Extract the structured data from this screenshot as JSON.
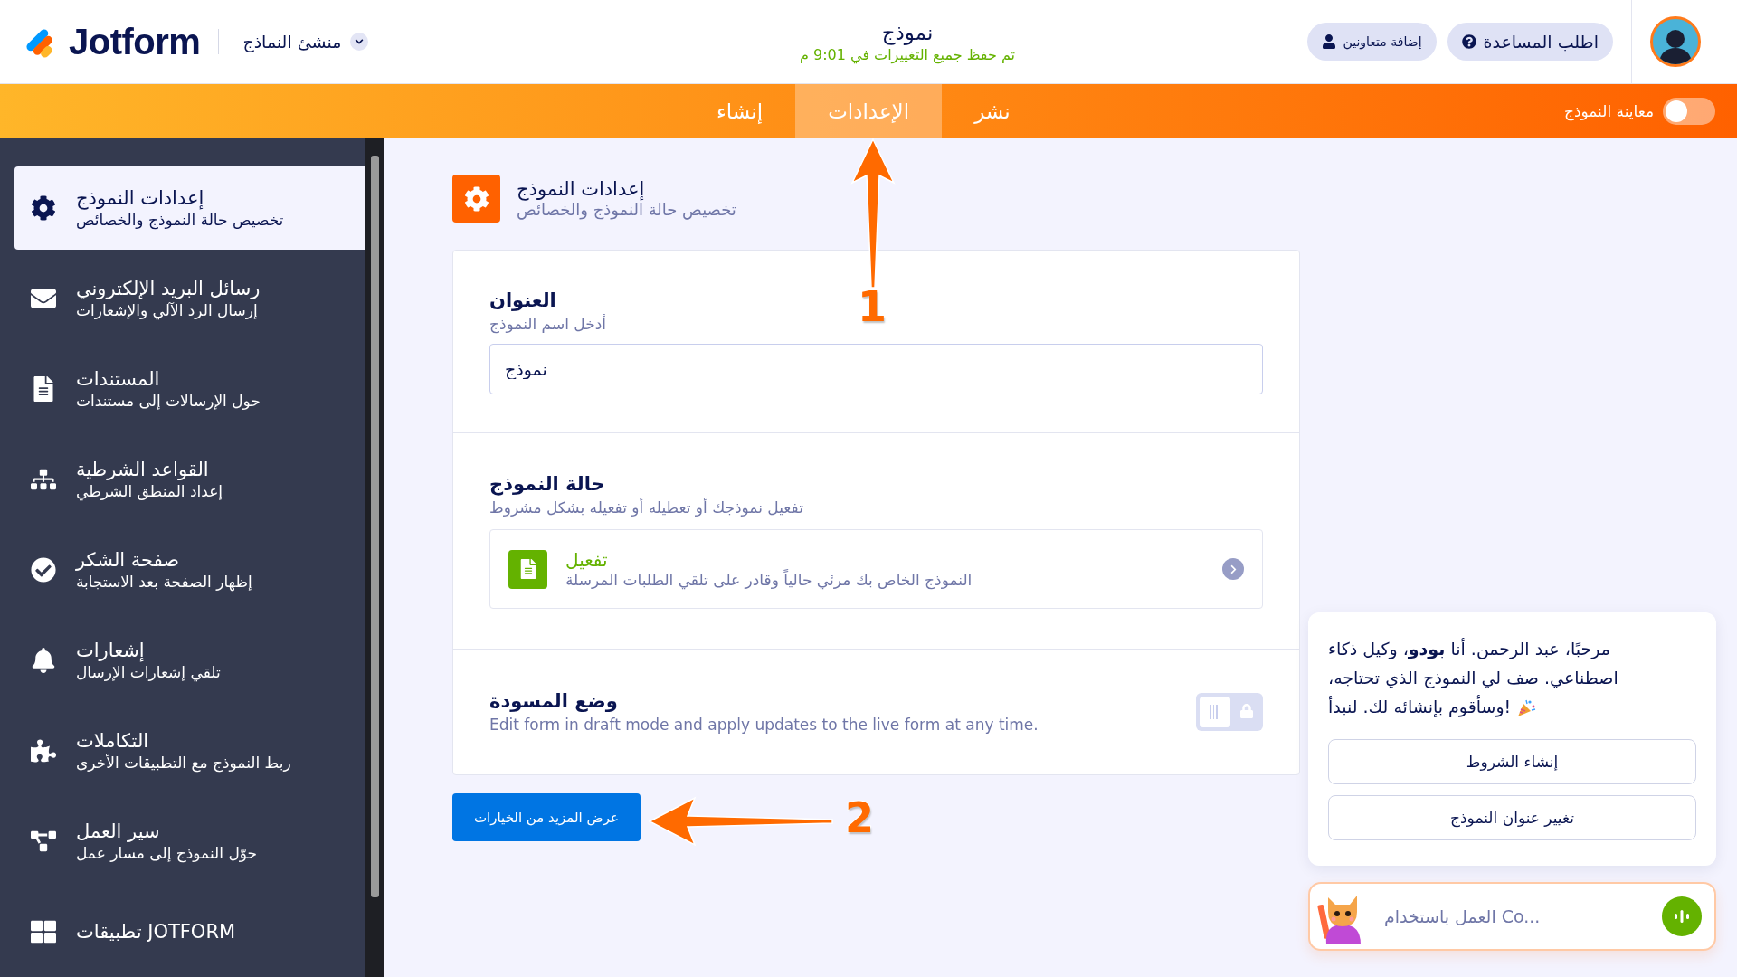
{
  "header": {
    "logo": "Jotform",
    "builder_menu": "منشئ النماذج",
    "form_title": "نموذج",
    "save_status": "تم حفظ جميع التغييرات في 9:01 م",
    "buttons": [
      {
        "label": "اطلب المساعدة",
        "kind": "help"
      },
      {
        "label": "إضافة متعاونين",
        "kind": "collaborators"
      }
    ]
  },
  "tabs": [
    {
      "label": "نشر",
      "selected": false
    },
    {
      "label": "الإعدادات",
      "selected": true
    },
    {
      "label": "إنشاء",
      "selected": false
    }
  ],
  "preview_toggle": {
    "label": "معاينة النموذج",
    "on": false
  },
  "sidebar": {
    "items": [
      {
        "title": "إعدادات النموذج",
        "subtitle": "تخصيص حالة النموذج والخصائص",
        "selected": true
      },
      {
        "title": "رسائل البريد الإلكتروني",
        "subtitle": "إرسال الرد الآلي والإشعارات",
        "selected": false
      },
      {
        "title": "المستندات",
        "subtitle": "حول الإرسالات إلى مستندات",
        "selected": false
      },
      {
        "title": "القواعد الشرطية",
        "subtitle": "إعداد المنطق الشرطي",
        "selected": false
      },
      {
        "title": "صفحة الشكر",
        "subtitle": "إظهار الصفحة بعد الاستجابة",
        "selected": false
      },
      {
        "title": "إشعارات",
        "subtitle": "تلقي إشعارات الإرسال",
        "selected": false
      },
      {
        "title": "التكاملات",
        "subtitle": "ربط النموذج مع التطبيقات الأخرى",
        "selected": false
      },
      {
        "title": "سير العمل",
        "subtitle": "حوّل النموذج إلى مسار عمل",
        "selected": false
      },
      {
        "title": "تطبيقات JOTFORM",
        "selected": false
      }
    ]
  },
  "panel": {
    "title": "إعدادات النموذج",
    "subtitle": "تخصيص حالة النموذج والخصائص",
    "sections": [
      {
        "kind": "text_input",
        "title": "العنوان",
        "description": "أدخل اسم النموذج",
        "value": "نموذج"
      },
      {
        "kind": "status",
        "title": "حالة النموذج",
        "description": "تفعيل نموذجك أو تعطيله أو تفعيله بشكل مشروط",
        "option": {
          "title": "تفعيل",
          "description": "النموذج الخاص بك مرئي حالياً وقادر على تلقي الطلبات المرسلة"
        }
      },
      {
        "kind": "toggle",
        "title": "وضع المسودة",
        "description": "Edit form in draft mode and apply updates to the live form at any time.",
        "on": false,
        "locked": true
      }
    ],
    "more_button": "عرض المزيد من الخيارات"
  },
  "annotations": [
    {
      "number": "1"
    },
    {
      "number": "2"
    }
  ],
  "assistant": {
    "message": "مرحبًا، عبد الرحمن. أنا **بودو**، وكيل ذكاء اصطناعي. صف لي النموذج الذي تحتاجه، وسأقوم بإنشائه لك. لنبدأ!",
    "suggestions": [
      "إنشاء الشروط",
      "تغيير عنوان النموذج"
    ],
    "input_placeholder": "العمل باستخدام Co..."
  }
}
